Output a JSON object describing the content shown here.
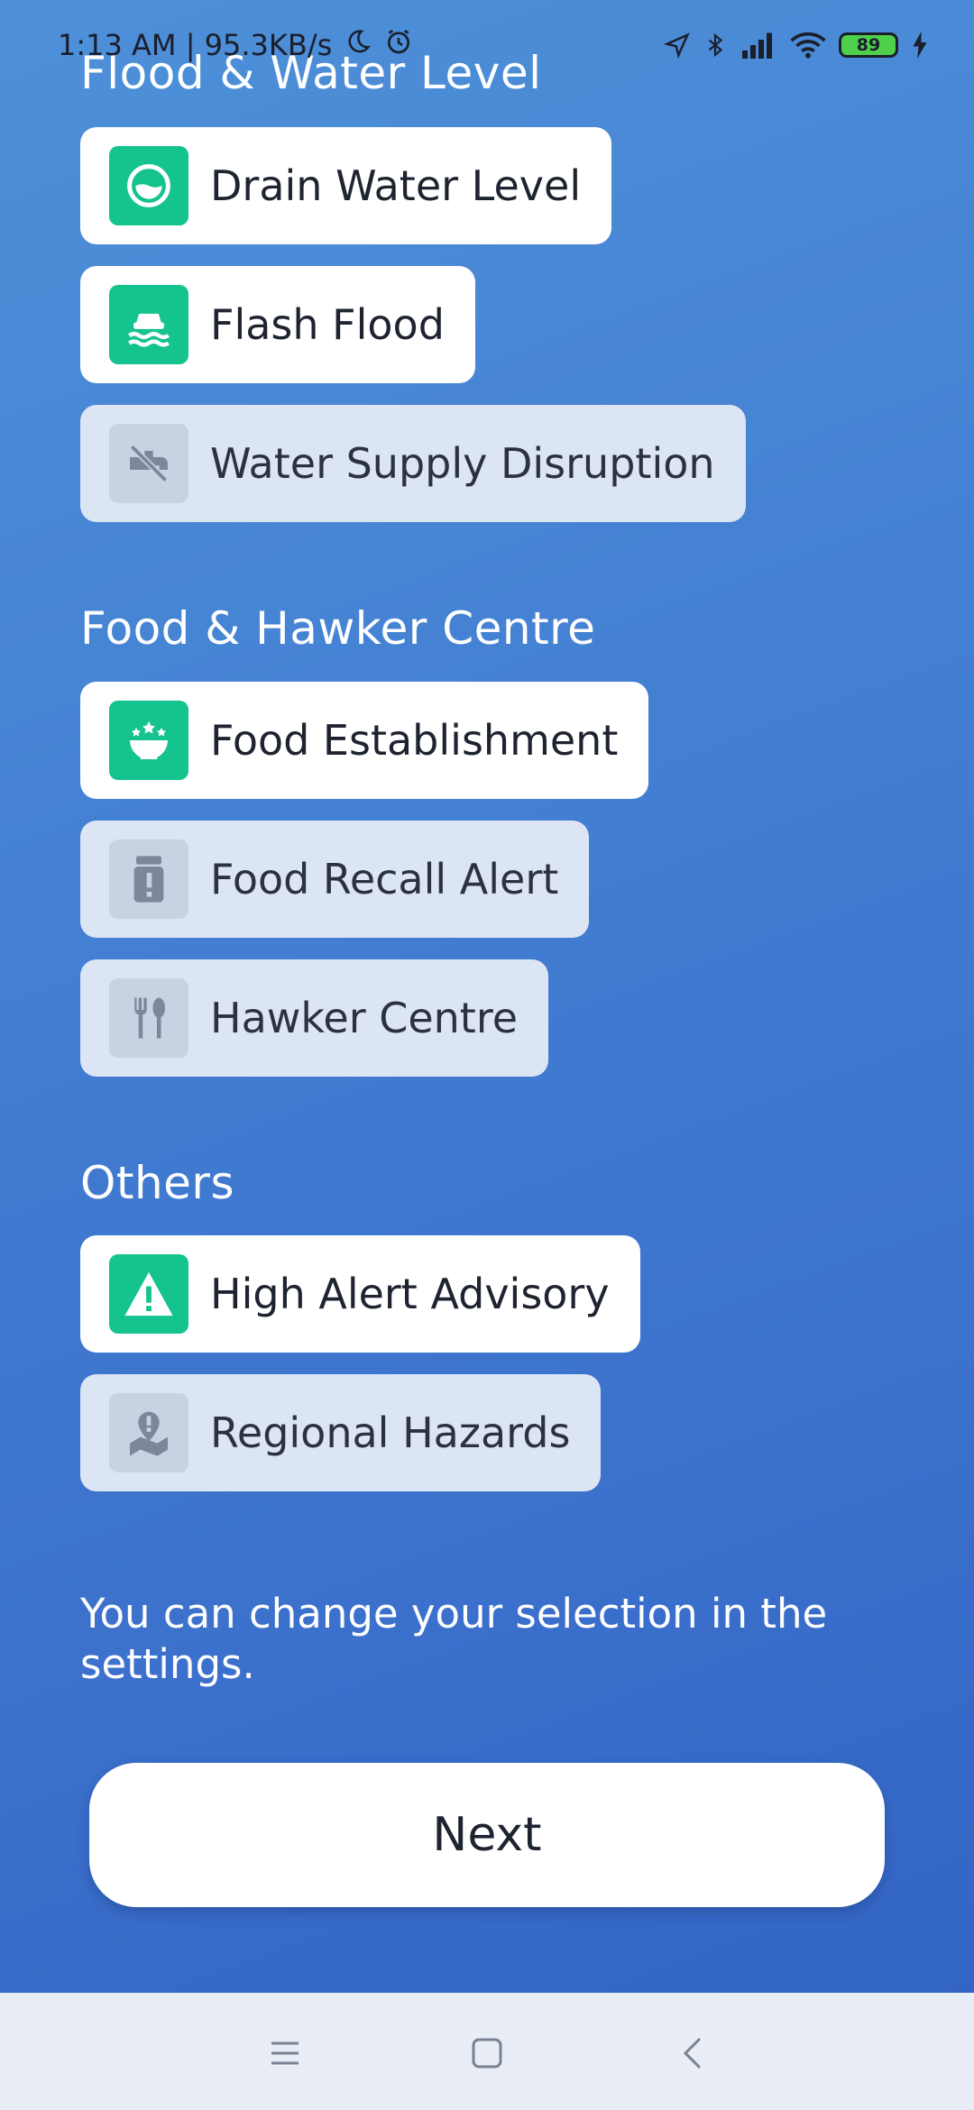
{
  "status_bar": {
    "time_and_speed": "1:13 AM | 95.3KB/s",
    "battery": "89"
  },
  "sections": [
    {
      "title": "Flood & Water Level",
      "items": [
        {
          "label": "Drain Water Level",
          "selected": true,
          "icon": "drain-level-icon"
        },
        {
          "label": "Flash Flood",
          "selected": true,
          "icon": "flash-flood-icon"
        },
        {
          "label": "Water Supply Disruption",
          "selected": false,
          "icon": "water-tap-icon"
        }
      ]
    },
    {
      "title": "Food & Hawker Centre",
      "items": [
        {
          "label": "Food Establishment",
          "selected": true,
          "icon": "food-bowl-icon"
        },
        {
          "label": "Food Recall Alert",
          "selected": false,
          "icon": "food-recall-icon"
        },
        {
          "label": "Hawker Centre",
          "selected": false,
          "icon": "fork-spoon-icon"
        }
      ]
    },
    {
      "title": "Others",
      "items": [
        {
          "label": "High Alert Advisory",
          "selected": true,
          "icon": "warning-icon"
        },
        {
          "label": "Regional Hazards",
          "selected": false,
          "icon": "map-pin-alert-icon"
        }
      ]
    }
  ],
  "hint_text": "You can change your selection in the settings.",
  "next_label": "Next",
  "colors": {
    "selected_icon_bg": "#14c38e",
    "unselected_chip_bg": "#dce5f3",
    "background_top": "#4e90d8",
    "background_bottom": "#3263c3"
  }
}
